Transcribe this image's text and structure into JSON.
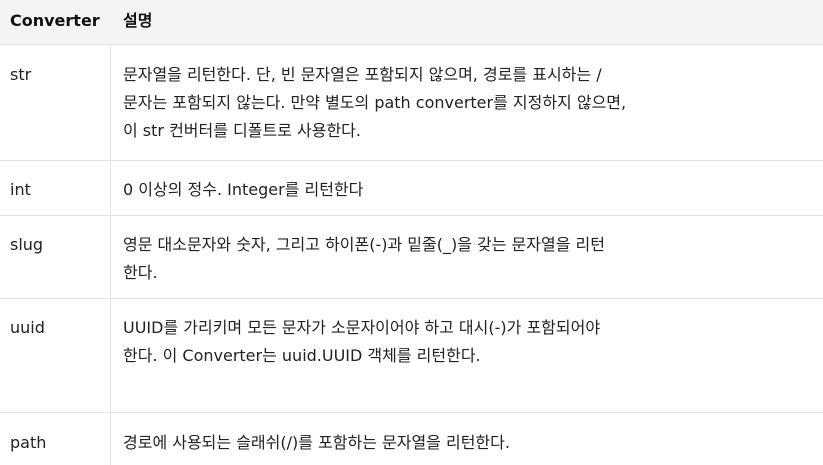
{
  "table": {
    "headers": {
      "key": "Converter",
      "desc": "설명"
    },
    "rows": [
      {
        "key": "str",
        "desc": "문자열을 리턴한다. 단, 빈 문자열은 포함되지 않으며, 경로를 표시하는 /\n문자는 포함되지 않는다. 만약 별도의 path converter를 지정하지 않으면,\n이 str 컨버터를 디폴트로 사용한다."
      },
      {
        "key": "int",
        "desc": "0 이상의 정수. Integer를 리턴한다"
      },
      {
        "key": "slug",
        "desc": "영문 대소문자와 숫자, 그리고 하이폰(-)과 밑줄(_)을 갖는 문자열을 리턴\n한다."
      },
      {
        "key": "uuid",
        "desc": "UUID를 가리키며 모든 문자가 소문자이어야 하고 대시(-)가 포함되어야\n한다. 이 Converter는 uuid.UUID 객체를 리턴한다."
      },
      {
        "key": "path",
        "desc": "경로에 사용되는 슬래쉬(/)를 포함하는 문자열을 리턴한다."
      }
    ]
  }
}
